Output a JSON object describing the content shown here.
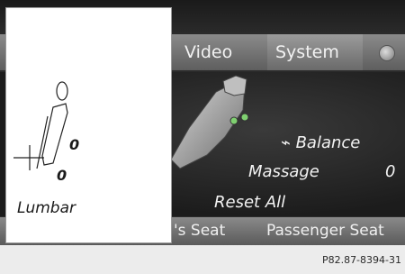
{
  "menu": {
    "video": "Video",
    "system": "System"
  },
  "seat_options": {
    "balance": "Balance",
    "massage": "Massage",
    "massage_value": "0",
    "reset_all": "Reset All"
  },
  "tabs": {
    "driver_seat": "'s Seat",
    "passenger_seat": "Passenger Seat"
  },
  "popup": {
    "value_upper": "0",
    "value_lower": "0",
    "label": "Lumbar"
  },
  "caption": "P82.87-8394-31",
  "icons": {
    "globe": "globe-icon",
    "balance": "seat-balance-icon",
    "lumbar": "lumbar-seat-icon"
  }
}
